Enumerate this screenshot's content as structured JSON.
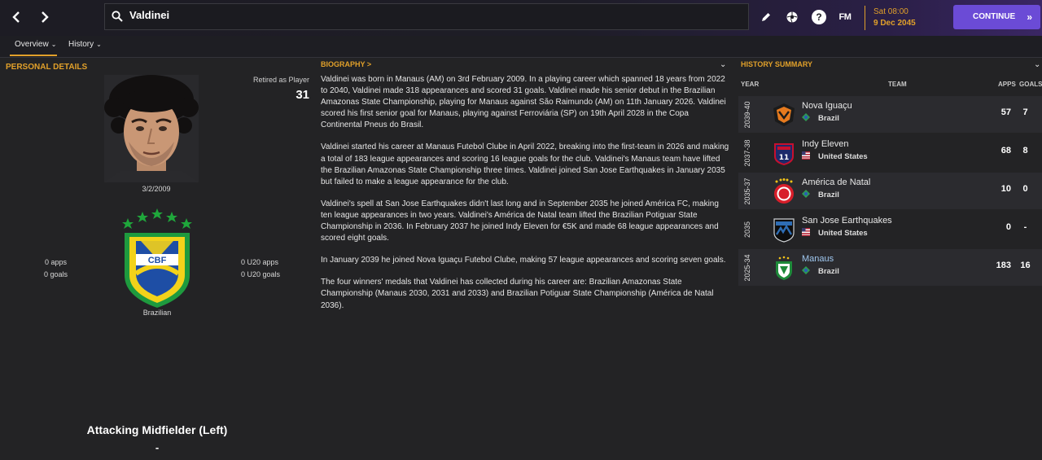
{
  "header": {
    "back_icon": "chevron-left-icon",
    "forward_icon": "chevron-right-icon",
    "search_value": "Valdinei",
    "edit_icon": "pencil-icon",
    "ball_icon": "football-icon",
    "help_label": "?",
    "fm_label": "FM",
    "date_day": "Sat 08:00",
    "date_full": "9 Dec 2045",
    "continue_label": "CONTINUE",
    "continue_icon": "double-chevron-right-icon"
  },
  "tabs": [
    {
      "label": "Overview",
      "active": true
    },
    {
      "label": "History",
      "active": false
    }
  ],
  "personal": {
    "title": "PERSONAL DETAILS",
    "retired_label": "Retired as Player",
    "retired_value": "31",
    "dob": "3/2/2009",
    "nationality": "Brazilian",
    "apps": "0 apps",
    "goals": "0 goals",
    "u20_apps": "0 U20 apps",
    "u20_goals": "0 U20 goals",
    "badge_text": "CBF",
    "position": "Attacking Midfielder (Left)",
    "position_sub": "-"
  },
  "biography": {
    "title": "BIOGRAPHY",
    "title_arrow": ">",
    "paragraphs": [
      "Valdinei was born in Manaus (AM) on 3rd February 2009. In a playing career which spanned 18 years from 2022 to 2040, Valdinei made 318 appearances and scored 31 goals. Valdinei made his senior debut in the Brazilian Amazonas State Championship, playing for Manaus against São Raimundo (AM) on 11th January 2026. Valdinei scored his first senior goal for Manaus, playing against Ferroviária (SP) on 19th April 2028 in the Copa Continental Pneus do Brasil.",
      "Valdinei started his career at Manaus Futebol Clube in April 2022, breaking into the first-team in 2026 and making a total of 183 league appearances and scoring 16 league goals for the club. Valdinei's Manaus team have lifted the Brazilian Amazonas State Championship three times. Valdinei joined San Jose Earthquakes in January 2035 but failed to make a league appearance for the club.",
      "Valdinei's spell at San Jose Earthquakes didn't last long and in September 2035 he joined América FC, making ten league appearances in two years. Valdinei's América de Natal team lifted the Brazilian Potiguar State Championship in 2036. In February 2037 he joined Indy Eleven for €5K and made 68 league appearances and scored eight goals.",
      "In January 2039 he joined Nova Iguaçu Futebol Clube, making 57 league appearances and scoring seven goals.",
      "The four winners' medals that Valdinei has collected during his career are: Brazilian Amazonas State Championship (Manaus 2030, 2031 and 2033) and Brazilian Potiguar State Championship (América de Natal 2036)."
    ]
  },
  "history": {
    "title": "HISTORY SUMMARY",
    "col_year": "YEAR",
    "col_team": "TEAM",
    "col_apps": "APPS",
    "col_goals": "GOALS",
    "rows": [
      {
        "year": "2039-40",
        "team": "Nova Iguaçu",
        "country": "Brazil",
        "apps": "57",
        "goals": "7"
      },
      {
        "year": "2037-38",
        "team": "Indy Eleven",
        "country": "United States",
        "apps": "68",
        "goals": "8"
      },
      {
        "year": "2035-37",
        "team": "América de Natal",
        "country": "Brazil",
        "apps": "10",
        "goals": "0"
      },
      {
        "year": "2035",
        "team": "San Jose Earthquakes",
        "country": "United States",
        "apps": "0",
        "goals": "-"
      },
      {
        "year": "2025-34",
        "team": "Manaus",
        "country": "Brazil",
        "apps": "183",
        "goals": "16"
      }
    ]
  },
  "colors": {
    "accent": "#e1a02a",
    "continue": "#6b4bd6",
    "link": "#9fc7ef"
  }
}
